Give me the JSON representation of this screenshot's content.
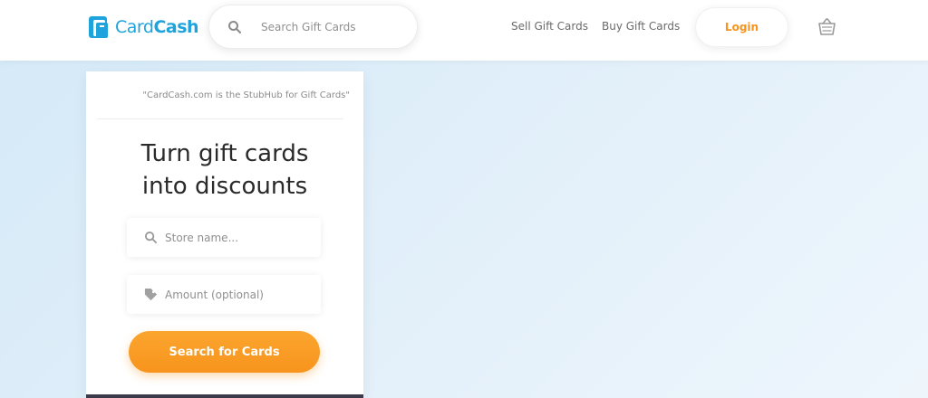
{
  "header": {
    "logo": {
      "part1": "Card",
      "part2": "Cash",
      "brand_color": "#1fa3dc"
    },
    "search": {
      "placeholder": "Search Gift Cards",
      "icon": "search-icon"
    },
    "nav": {
      "sell": "Sell Gift Cards",
      "buy": "Buy Gift Cards"
    },
    "login_label": "Login",
    "cart_icon": "basket-icon"
  },
  "hero": {
    "quote": "\"CardCash.com is the StubHub for Gift Cards\"",
    "headline_line1": "Turn gift cards",
    "headline_line2": "into discounts",
    "store_field": {
      "placeholder": "Store name...",
      "icon": "search-icon"
    },
    "amount_field": {
      "placeholder": "Amount (optional)",
      "icon": "tag-icon"
    },
    "cta_label": "Search for Cards",
    "accent_color": "#f7941d"
  }
}
